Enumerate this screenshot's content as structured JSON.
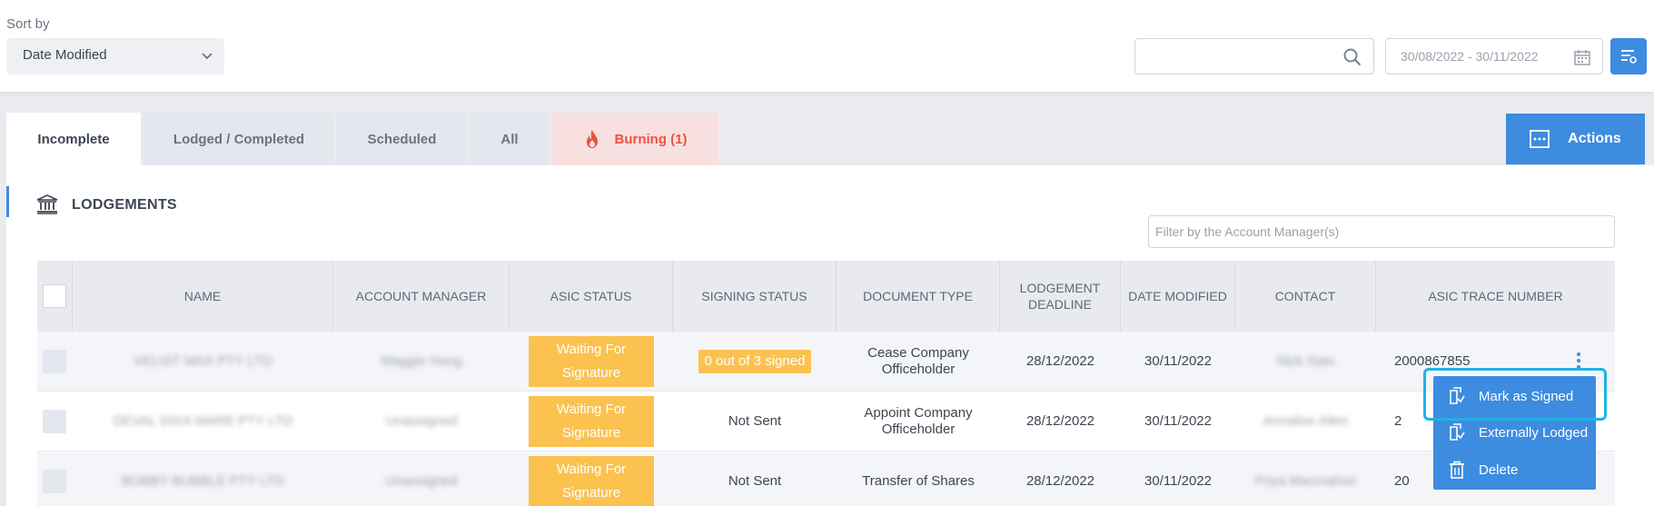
{
  "sort": {
    "label": "Sort by",
    "value": "Date Modified"
  },
  "date_range": {
    "value": "30/08/2022  -  30/11/2022"
  },
  "tabs": [
    {
      "label": "Incomplete"
    },
    {
      "label": "Lodged / Completed"
    },
    {
      "label": "Scheduled"
    },
    {
      "label": "All"
    },
    {
      "label": "Burning (1)"
    }
  ],
  "actions_label": "Actions",
  "section_title": "LODGEMENTS",
  "account_manager_filter": {
    "placeholder": "Filter by the Account Manager(s)"
  },
  "columns": [
    "NAME",
    "ACCOUNT MANAGER",
    "ASIC STATUS",
    "SIGNING STATUS",
    "DOCUMENT TYPE",
    "LODGEMENT DEADLINE",
    "DATE MODIFIED",
    "CONTACT",
    "ASIC TRACE NUMBER"
  ],
  "rows": [
    {
      "name": "VELIST MAX PTY LTD",
      "account_manager": "Maggie Hong",
      "asic_status": "Waiting For Signature",
      "signing_status": "0 out of 3 signed",
      "document_type": "Cease Company Officeholder",
      "deadline": "28/12/2022",
      "date_modified": "30/11/2022",
      "contact": "Nick Sato",
      "trace_number": "2000867855"
    },
    {
      "name": "DEVAL DIXA MARE PTY LTD",
      "account_manager": "Unassigned",
      "asic_status": "Waiting For Signature",
      "signing_status": "Not Sent",
      "document_type": "Appoint Company Officeholder",
      "deadline": "28/12/2022",
      "date_modified": "30/11/2022",
      "contact": "Annalise Allen",
      "trace_number": "2"
    },
    {
      "name": "BOBBY BUBBLE PTY LTD",
      "account_manager": "Unassigned",
      "asic_status": "Waiting For Signature",
      "signing_status": "Not Sent",
      "document_type": "Transfer of Shares",
      "deadline": "28/12/2022",
      "date_modified": "30/11/2022",
      "contact": "Priya Macmahon",
      "trace_number": "20"
    }
  ],
  "row_menu": [
    {
      "label": "Mark as Signed",
      "icon": "document-check-icon"
    },
    {
      "label": "Externally Lodged",
      "icon": "document-check-icon"
    },
    {
      "label": "Delete",
      "icon": "trash-icon"
    }
  ],
  "colors": {
    "accent": "#3d8ce0",
    "warning": "#fcc24f",
    "burning": "#e8543f",
    "highlight": "#1fb2e4"
  }
}
